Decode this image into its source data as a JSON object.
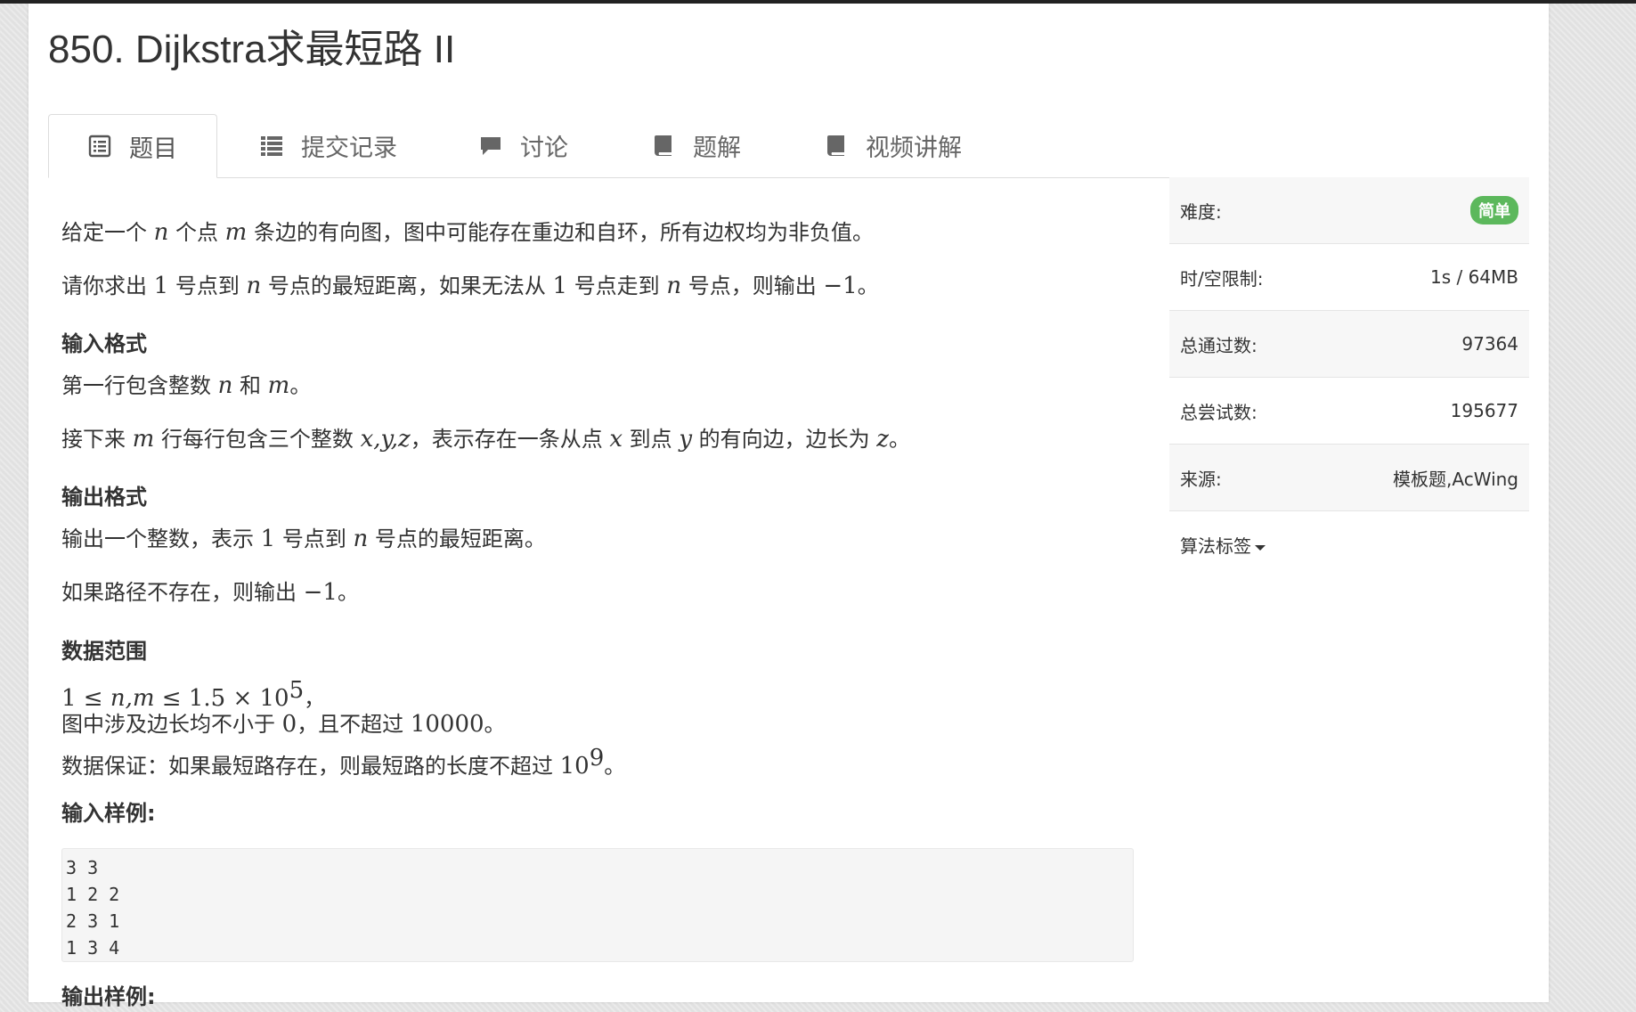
{
  "problem": {
    "title": "850. Dijkstra求最短路 II"
  },
  "tabs": [
    {
      "label": "题目",
      "icon": "list-alt-icon",
      "active": true
    },
    {
      "label": "提交记录",
      "icon": "list-icon",
      "active": false
    },
    {
      "label": "讨论",
      "icon": "comment-icon",
      "active": false
    },
    {
      "label": "题解",
      "icon": "book-icon",
      "active": false
    },
    {
      "label": "视频讲解",
      "icon": "book-icon",
      "active": false
    }
  ],
  "description": {
    "p1": {
      "a": "给定一个",
      "n": "n",
      "b": "个点",
      "m": "m",
      "c": "条边的有向图，图中可能存在重边和自环，所有边权均为非负值。"
    },
    "p2": {
      "a": "请你求出",
      "one1": "1",
      "b": "号点到",
      "n": "n",
      "c": "号点的最短距离，如果无法从",
      "one2": "1",
      "d": "号点走到",
      "n2": "n",
      "e": "号点，则输出",
      "neg": "−1",
      "f": "。"
    },
    "input_heading": "输入格式",
    "in1": {
      "a": "第一行包含整数",
      "n": "n",
      "b": "和",
      "m": "m",
      "c": "。"
    },
    "in2": {
      "a": "接下来",
      "m": "m",
      "b": "行每行包含三个整数",
      "xyz": "x,y,z",
      "c": "，表示存在一条从点",
      "x": "x",
      "d": "到点",
      "y": "y",
      "e": "的有向边，边长为",
      "z": "z",
      "f": "。"
    },
    "output_heading": "输出格式",
    "out1": {
      "a": "输出一个整数，表示",
      "one": "1",
      "b": "号点到",
      "n": "n",
      "c": "号点的最短距离。"
    },
    "out2": {
      "a": "如果路径不存在，则输出",
      "neg": "−1",
      "b": "。"
    },
    "range_heading": "数据范围",
    "r1": {
      "a": "1 ≤ ",
      "nm": "n,m",
      "b": " ≤ 1.5 × 10",
      "exp": "5",
      "c": "，"
    },
    "r2": {
      "a": "图中涉及边长均不小于",
      "zero": "0",
      "b": "，且不超过",
      "max": "10000",
      "c": "。"
    },
    "r3": {
      "a": "数据保证：如果最短路存在，则最短路的长度不超过",
      "base": "10",
      "exp": "9",
      "b": "。"
    },
    "sample_in_heading": "输入样例:",
    "sample_in": [
      "3 3",
      "1 2 2",
      "2 3 1",
      "1 3 4"
    ],
    "sample_out_heading": "输出样例:"
  },
  "sidebar": {
    "difficulty_label": "难度:",
    "difficulty_value": "简单",
    "difficulty_color": "#5cb85c",
    "limit_label": "时/空限制:",
    "limit_value": "1s / 64MB",
    "passed_label": "总通过数:",
    "passed_value": "97364",
    "tried_label": "总尝试数:",
    "tried_value": "195677",
    "source_label": "来源:",
    "source_value": "模板题,AcWing",
    "tags_label": "算法标签"
  }
}
